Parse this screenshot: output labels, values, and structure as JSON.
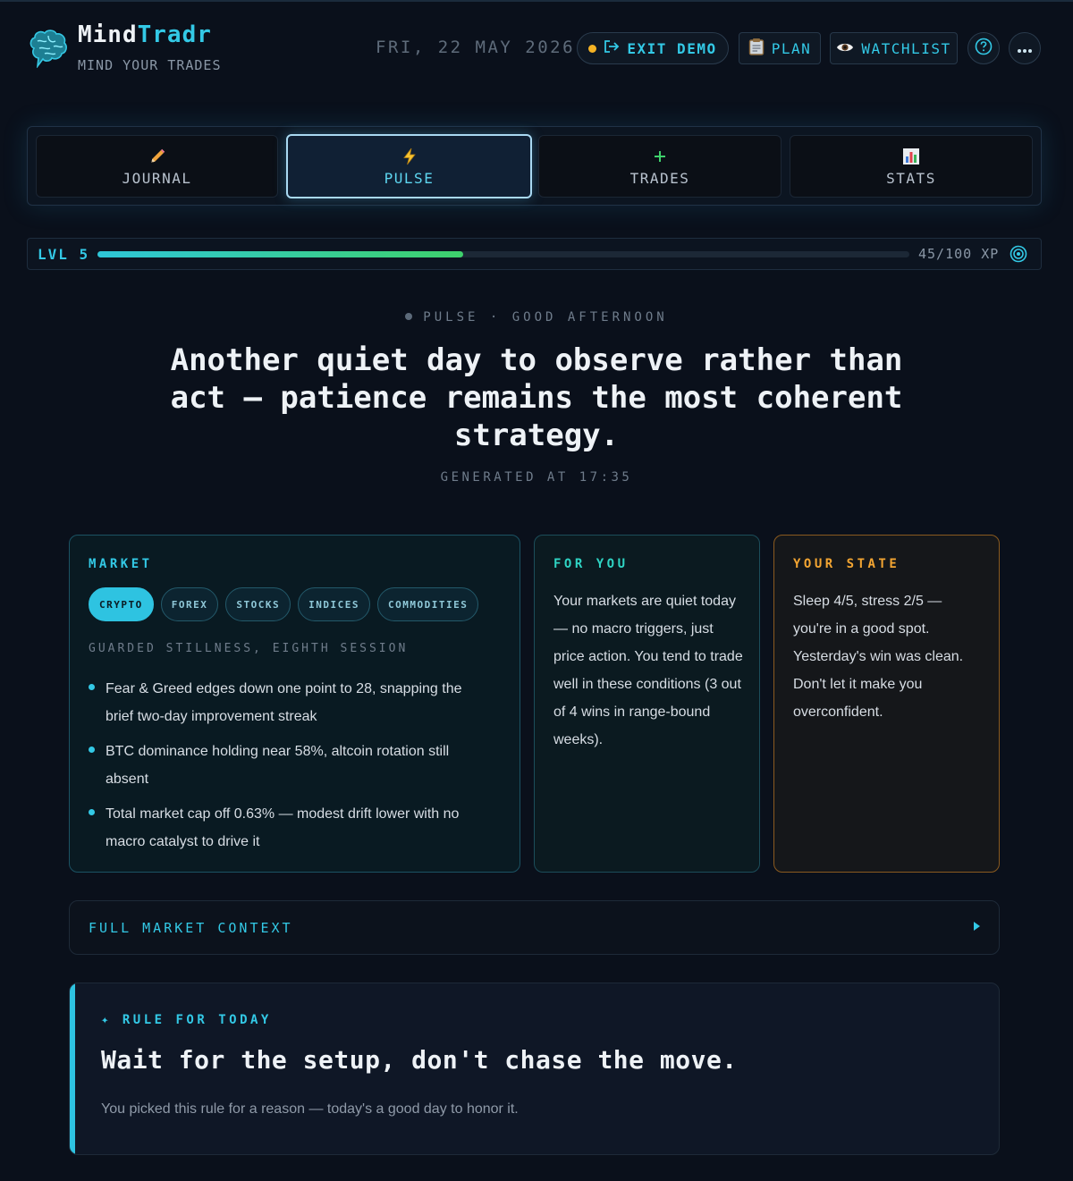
{
  "app": {
    "name_part1": "Mind",
    "name_part2": "Tradr",
    "tagline": "MIND YOUR TRADES",
    "logo_icon": "brain-icon"
  },
  "header": {
    "date": "FRI, 22 MAY 2026",
    "exit_demo_label": "EXIT DEMO",
    "plan_label": "PLAN",
    "watchlist_label": "WATCHLIST",
    "help_icon": "question-circle-icon",
    "more_icon": "ellipsis-icon"
  },
  "tabs": [
    {
      "label": "JOURNAL",
      "icon": "pencil-icon",
      "active": false
    },
    {
      "label": "PULSE",
      "icon": "lightning-icon",
      "active": true
    },
    {
      "label": "TRADES",
      "icon": "plus-icon",
      "active": false
    },
    {
      "label": "STATS",
      "icon": "bar-chart-icon",
      "active": false
    }
  ],
  "xp": {
    "level_label": "LVL 5",
    "current": 45,
    "max": 100,
    "text": "45/100 XP",
    "progress_fraction": 0.45
  },
  "pulse": {
    "eyebrow": "PULSE · GOOD AFTERNOON",
    "headline": "Another quiet day to observe rather than act — patience remains the most coherent strategy.",
    "generated": "GENERATED AT 17:35"
  },
  "market": {
    "title": "MARKET",
    "chips": [
      "CRYPTO",
      "FOREX",
      "STOCKS",
      "INDICES",
      "COMMODITIES"
    ],
    "active_chip": "CRYPTO",
    "subtitle": "GUARDED STILLNESS, EIGHTH SESSION",
    "bullets": [
      "Fear & Greed edges down one point to 28, snapping the brief two-day improvement streak",
      "BTC dominance holding near 58%, altcoin rotation still absent",
      "Total market cap off 0.63% — modest drift lower with no macro catalyst to drive it"
    ]
  },
  "for_you": {
    "title": "FOR YOU",
    "text": "Your markets are quiet today — no macro triggers, just price action. You tend to trade well in these conditions (3 out of 4 wins in range-bound weeks)."
  },
  "your_state": {
    "title": "YOUR STATE",
    "text": "Sleep 4/5, stress 2/5 — you're in a good spot. Yesterday's win was clean. Don't let it make you overconfident."
  },
  "full_market_context": {
    "label": "FULL MARKET CONTEXT"
  },
  "rule": {
    "eyebrow": "✦ RULE FOR TODAY",
    "title": "Wait for the setup, don't chase the move.",
    "note": "You picked this rule for a reason — today's a good day to honor it."
  },
  "colors": {
    "accent": "#33c9e6",
    "background": "#0a101b",
    "amber": "#f3a532",
    "teal": "#2fd4c4",
    "xp_gradient_end": "#3ed16b"
  }
}
